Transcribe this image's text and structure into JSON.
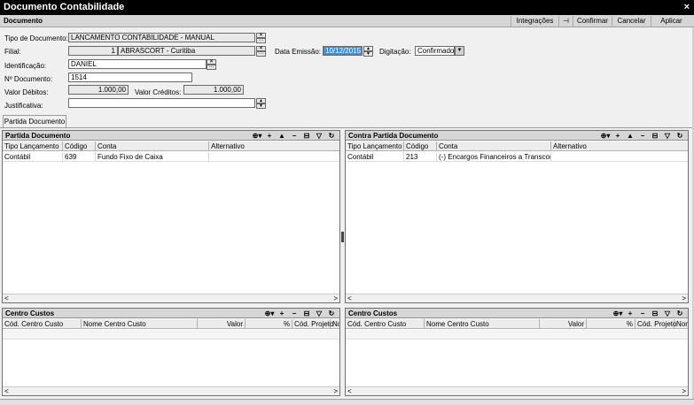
{
  "window": {
    "title": "Documento Contabilidade",
    "close": "×"
  },
  "toolbar": {
    "section": "Documento",
    "integracoes": "Integrações",
    "pin_icon": "⊣",
    "confirmar": "Confirmar",
    "cancelar": "Cancelar",
    "aplicar": "Aplicar"
  },
  "form": {
    "tipo_documento": {
      "label": "Tipo de Documento:",
      "value": "LANCAMENTO CONTABILIDADE - MANUAL"
    },
    "filial": {
      "label": "Filial:",
      "code": "1",
      "name": "ABRASCORT - Curitiba"
    },
    "data_emissao": {
      "label": "Data Emissão:",
      "value": "10/12/2015"
    },
    "digitacao": {
      "label": "Digitação:",
      "value": "Confirmado"
    },
    "identificacao": {
      "label": "Identificação:",
      "value": "DANIEL"
    },
    "n_documento": {
      "label": "Nº Documento:",
      "value": "1514"
    },
    "valor_debitos": {
      "label": "Valor Débitos:",
      "value": "1.000,00"
    },
    "valor_creditos": {
      "label": "Valor Créditos:",
      "value": "1.000,00"
    },
    "justificativa": {
      "label": "Justificativa:",
      "value": ""
    }
  },
  "icons": {
    "clear": "✕",
    "more": "…",
    "dropdown": "▼",
    "up": "▲",
    "down": "▼",
    "left": "<",
    "right": ">"
  },
  "tabs": [
    {
      "label": "Partida Documento"
    }
  ],
  "panel_icons": {
    "config": "⊕▾",
    "add": "+",
    "up": "▲",
    "remove": "−",
    "export": "⊟",
    "filter": "▽",
    "refresh": "↻"
  },
  "partida": {
    "title": "Partida Documento",
    "columns": [
      "Tipo Lançamento",
      "Código",
      "Conta",
      "Alternativo"
    ],
    "rows": [
      {
        "tipo": "Contábil",
        "codigo": "639",
        "conta": "Fundo Fixo de Caixa",
        "alt": ""
      }
    ]
  },
  "contra": {
    "title": "Contra Partida Documento",
    "columns": [
      "Tipo Lançamento",
      "Código",
      "Conta",
      "Alternativo"
    ],
    "rows": [
      {
        "tipo": "Contábil",
        "codigo": "213",
        "conta": "(-) Encargos Financeiros a Transcorrer",
        "alt": ""
      }
    ]
  },
  "custos_left": {
    "title": "Centro Custos",
    "columns": [
      "Cód. Centro Custo",
      "Nome Centro Custo",
      "Valor",
      "%",
      "Cód. Projeto",
      "No"
    ]
  },
  "custos_right": {
    "title": "Centro Custos",
    "columns": [
      "Cód. Centro Custo",
      "Nome Centro Custo",
      "Valor",
      "%",
      "Cód. Projeto",
      "Nom"
    ]
  }
}
